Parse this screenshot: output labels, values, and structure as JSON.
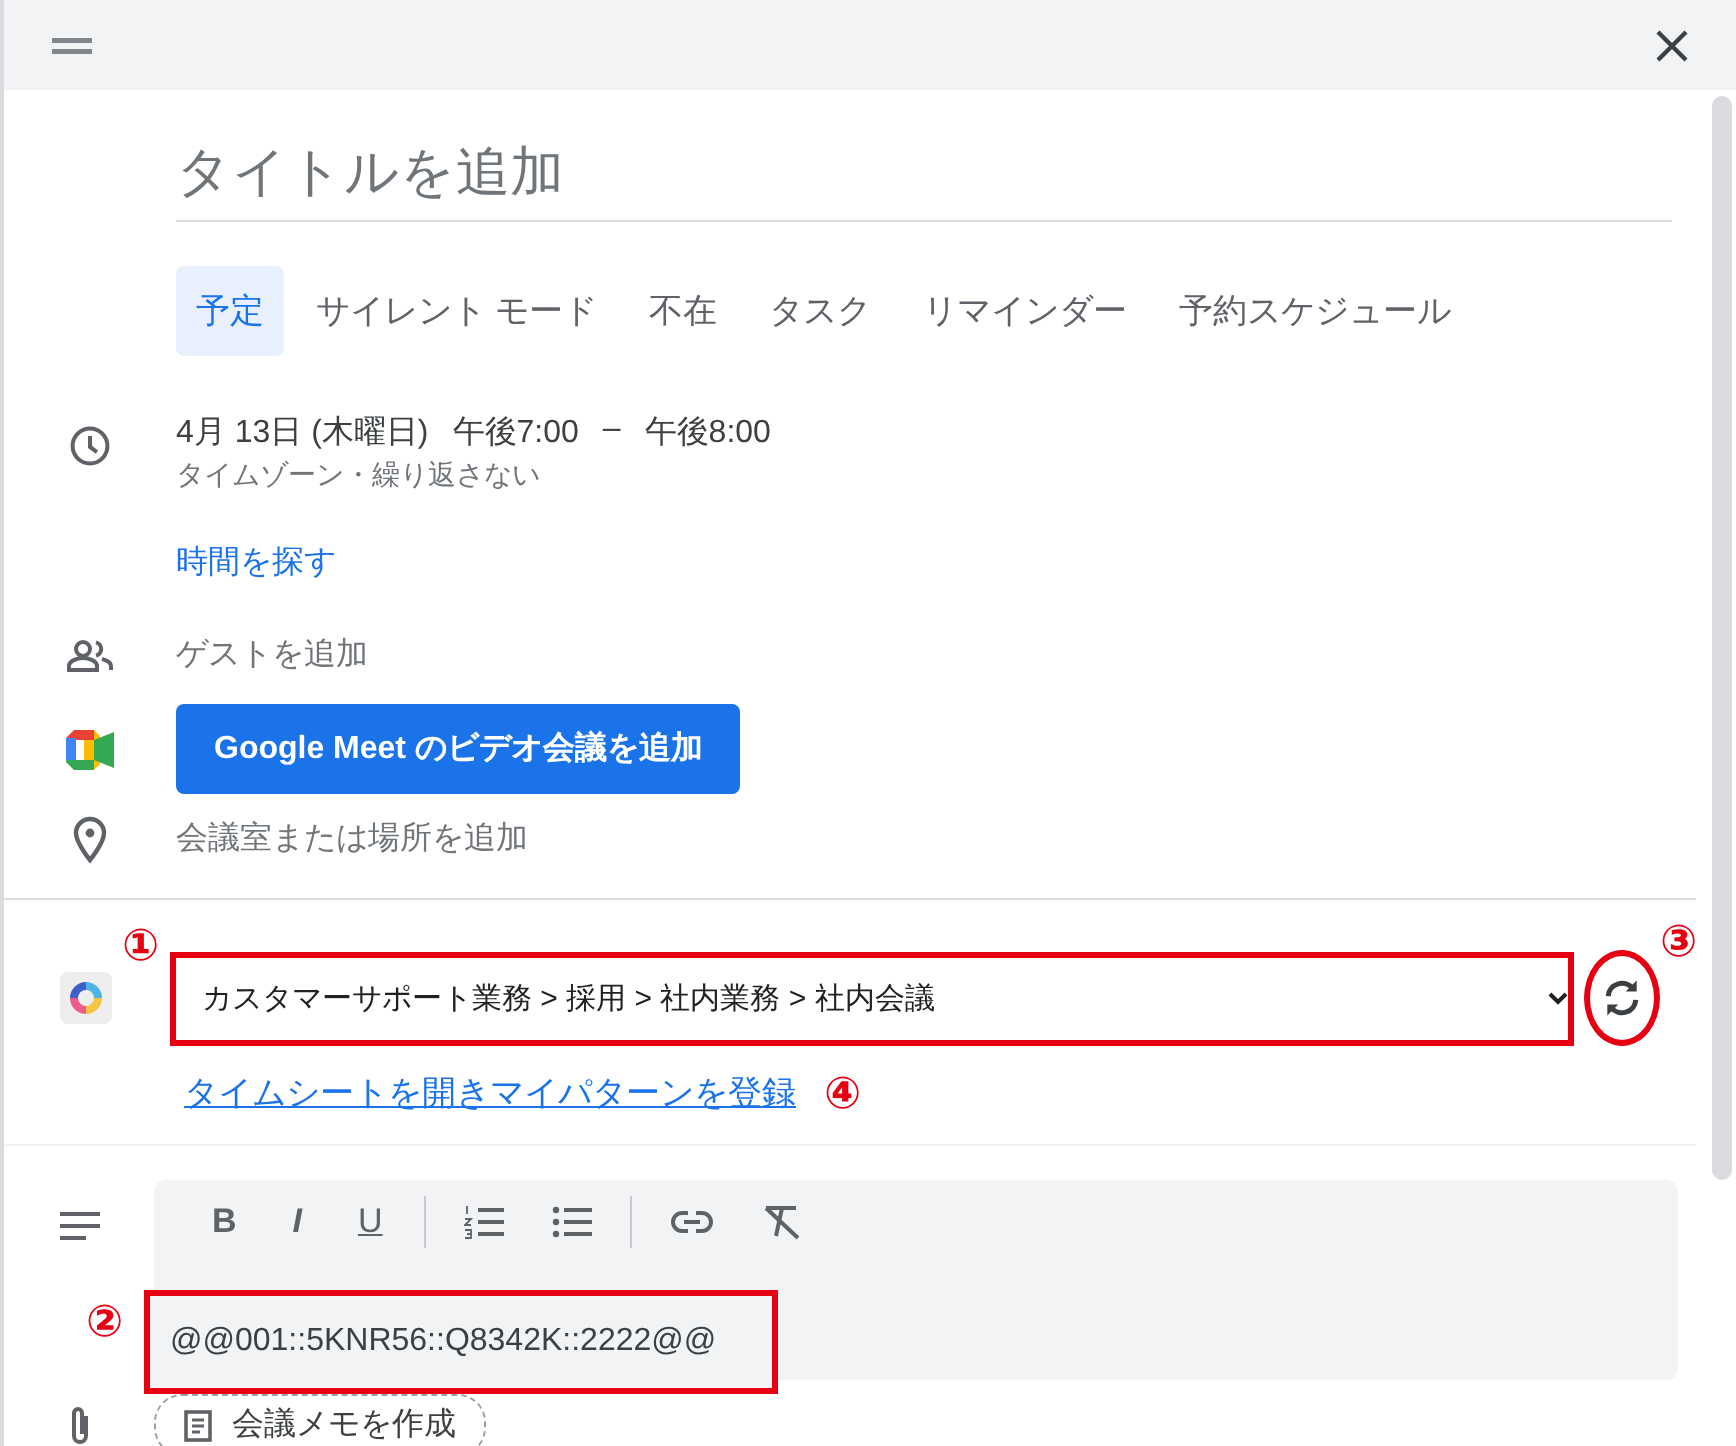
{
  "title_field": {
    "placeholder": "タイトルを追加"
  },
  "tabs": [
    {
      "label": "予定",
      "selected": true
    },
    {
      "label": "サイレント モード",
      "selected": false
    },
    {
      "label": "不在",
      "selected": false
    },
    {
      "label": "タスク",
      "selected": false
    },
    {
      "label": "リマインダー",
      "selected": false
    },
    {
      "label": "予約スケジュール",
      "selected": false
    }
  ],
  "datetime": {
    "date": "4月 13日 (木曜日)",
    "start": "午後7:00",
    "separator": "–",
    "end": "午後8:00",
    "detail": "タイムゾーン・繰り返さない"
  },
  "find_time_link": "時間を探す",
  "guests_field": {
    "placeholder": "ゲストを追加"
  },
  "meet_button": "Google Meet のビデオ会議を追加",
  "location_field": {
    "placeholder": "会議室または場所を追加"
  },
  "task_select": {
    "value": "カスタマーサポート業務 > 採用 > 社内業務 > 社内会議"
  },
  "timesheet_link": "タイムシートを開きマイパターンを登録",
  "description": {
    "toolbar": [
      {
        "kind": "bold",
        "label": "B"
      },
      {
        "kind": "italic",
        "label": "I"
      },
      {
        "kind": "underline",
        "label": "U"
      },
      {
        "kind": "numbered-list"
      },
      {
        "kind": "bulleted-list"
      },
      {
        "kind": "link"
      },
      {
        "kind": "clear-format"
      }
    ],
    "value": "@@001::5KNR56::Q8342K::2222@@"
  },
  "notes_button": "会議メモを作成",
  "callouts": [
    "①",
    "②",
    "③",
    "④"
  ]
}
